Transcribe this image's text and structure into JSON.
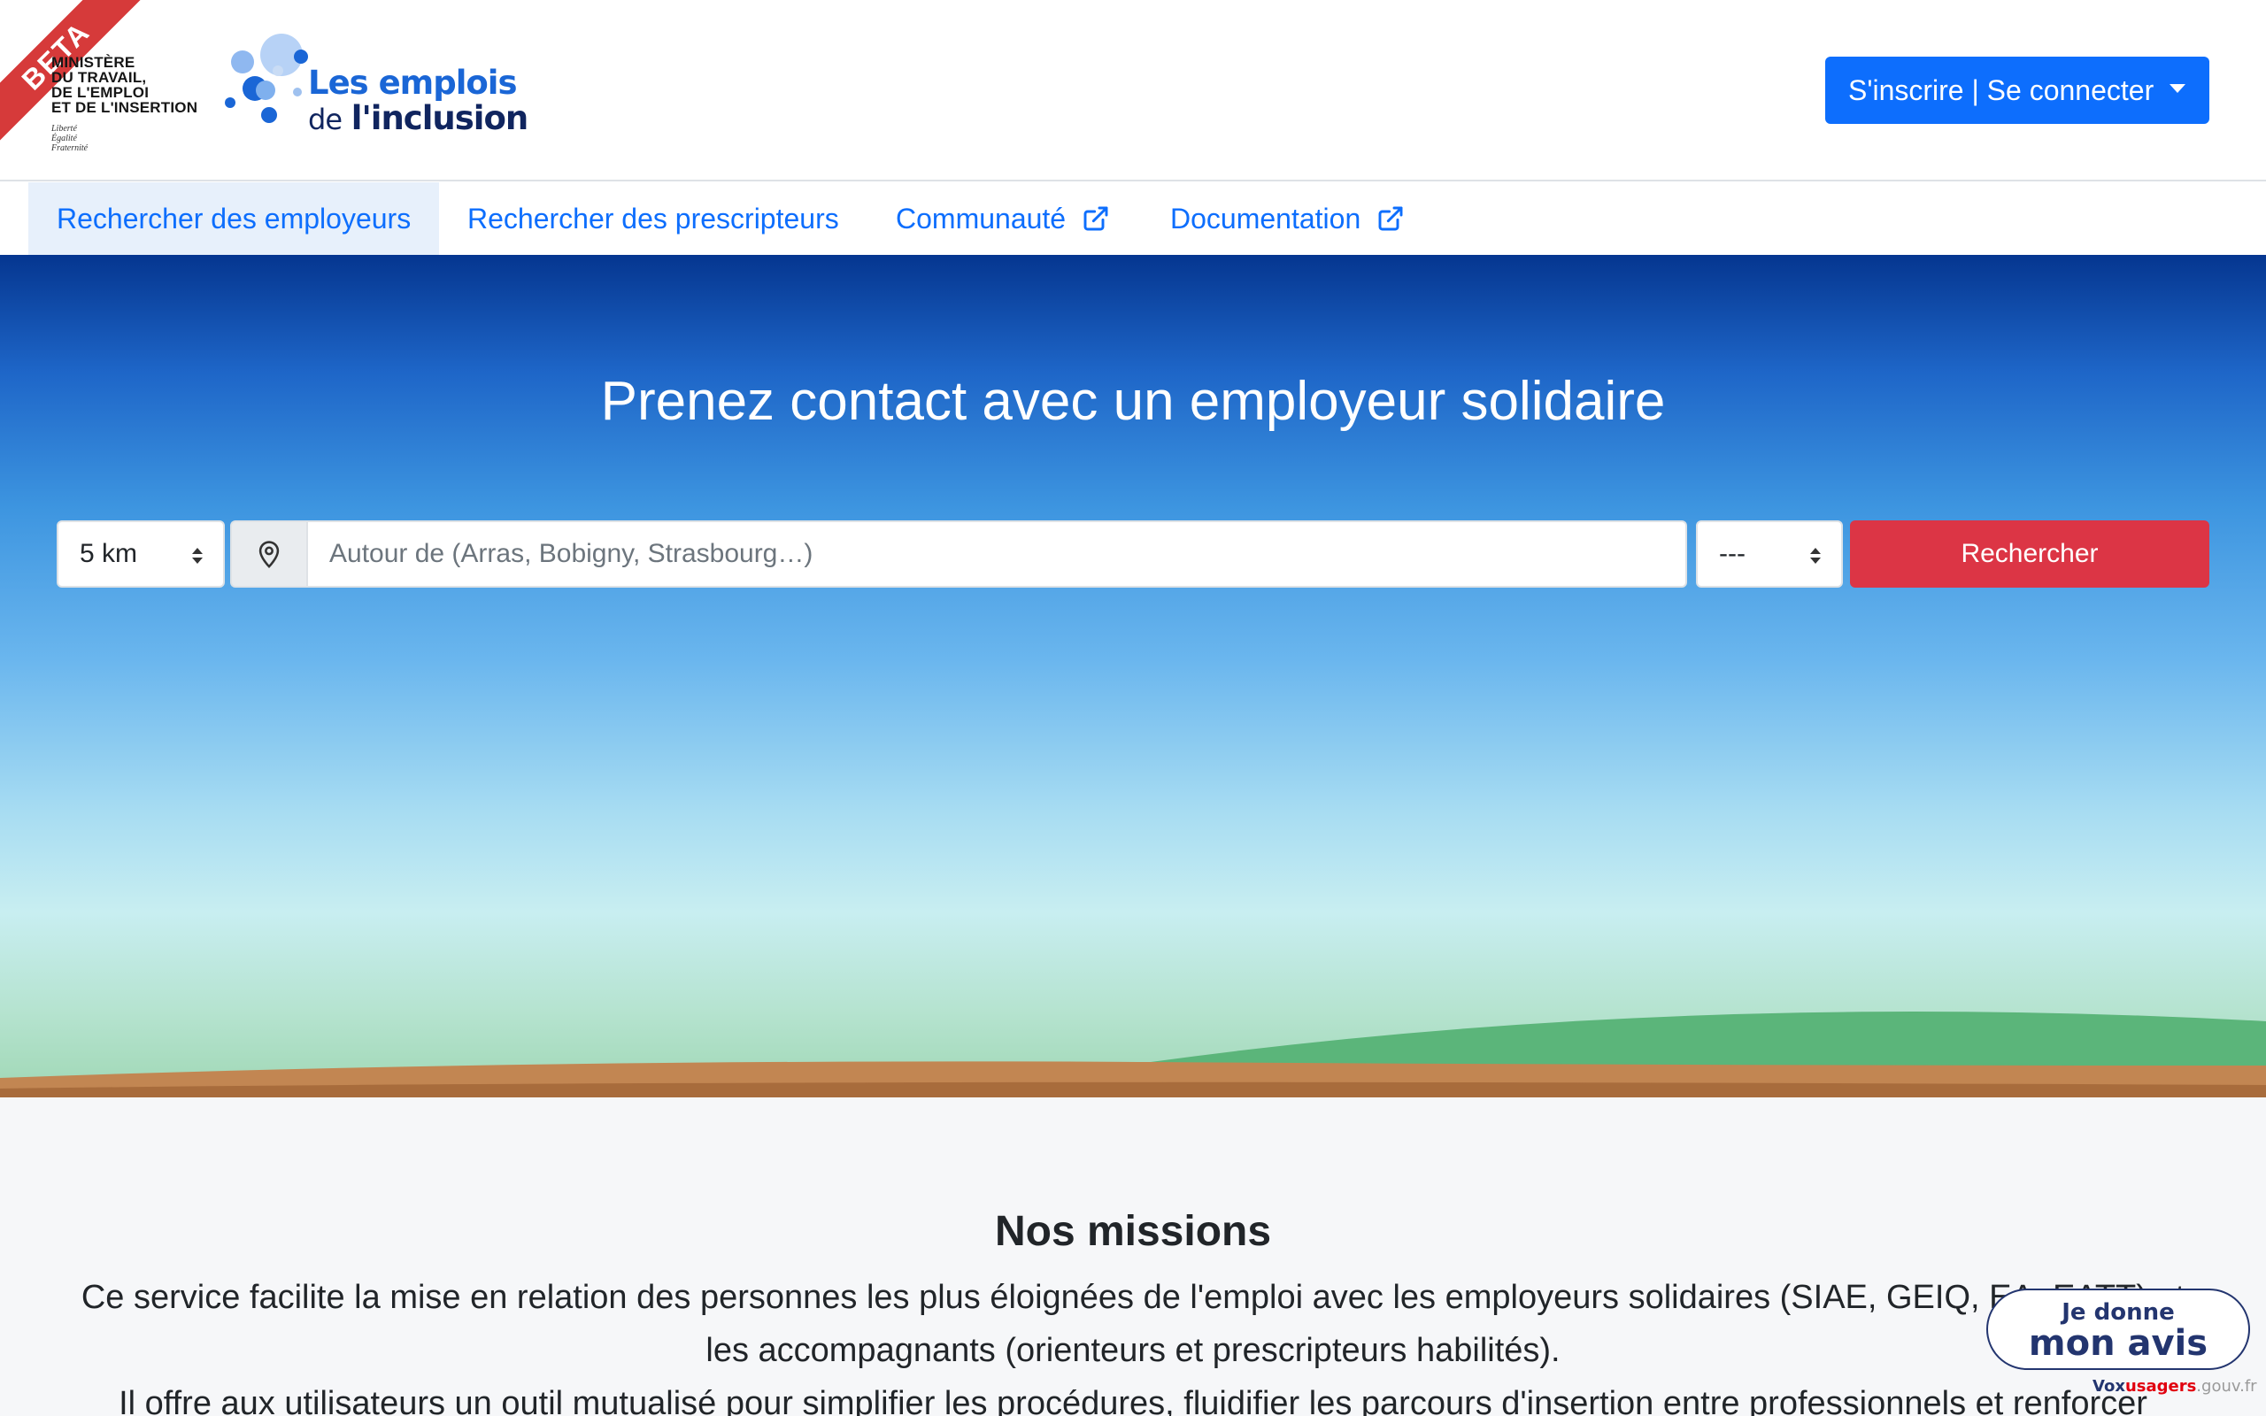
{
  "header": {
    "beta_label": "BETA",
    "ministere_lines": [
      "MINISTÈRE",
      "DU TRAVAIL,",
      "DE L'EMPLOI",
      "ET DE L'INSERTION"
    ],
    "devise": [
      "Liberté",
      "Égalité",
      "Fraternité"
    ],
    "logo_line1": "Les emplois",
    "logo_de": "de",
    "logo_inclusion": "l'inclusion",
    "auth_button": "S'inscrire | Se connecter"
  },
  "nav": {
    "items": [
      {
        "label": "Rechercher des employeurs",
        "active": true
      },
      {
        "label": "Rechercher des prescripteurs"
      },
      {
        "label": "Communauté",
        "external": true
      },
      {
        "label": "Documentation",
        "external": true
      }
    ]
  },
  "hero": {
    "title": "Prenez contact avec un employeur solidaire",
    "radius_value": "5 km",
    "city_placeholder": "Autour de (Arras, Bobigny, Strasbourg…)",
    "kind_value": "---",
    "search_button": "Rechercher"
  },
  "missions": {
    "title": "Nos missions",
    "paragraph1": "Ce service facilite la mise en relation des personnes les plus éloignées de l'emploi avec les employeurs solidaires (SIAE, GEIQ, EA, EATT) et les accompagnants (orienteurs et prescripteurs habilités).",
    "paragraph2": "Il offre aux utilisateurs un outil mutualisé pour simplifier les procédures, fluidifier les parcours d'insertion entre professionnels et renforcer"
  },
  "feedback": {
    "line1": "Je donne",
    "line2": "mon avis",
    "brand_vox": "Vox",
    "brand_usagers": "usagers",
    "brand_domain": ".gouv.fr"
  },
  "colors": {
    "primary": "#0d6efd",
    "danger": "#dc3545",
    "hero_top": "#053690",
    "logo_blue": "#1a66d6",
    "navy": "#10255f"
  }
}
